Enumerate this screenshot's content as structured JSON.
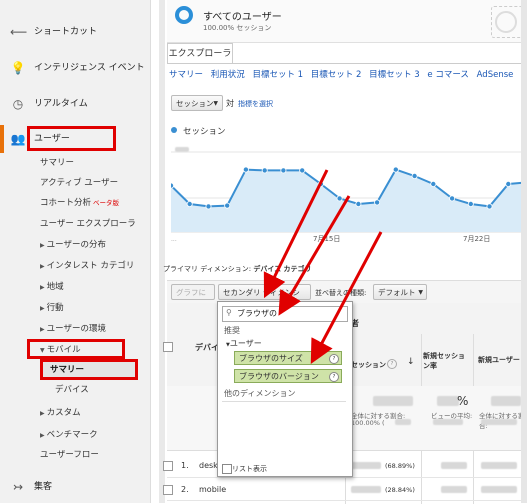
{
  "sidebar": {
    "shortcut": "ショートカット",
    "intelligence": "インテリジェンス イベント",
    "realtime": "リアルタイム",
    "users": "ユーザー",
    "users_items": {
      "summary": "サマリー",
      "active_users": "アクティブ ユーザー",
      "cohort": "コホート分析",
      "beta": "ベータ版",
      "user_explorer": "ユーザー エクスプローラ",
      "user_distribution": "ユーザーの分布",
      "interest_category": "インタレスト カテゴリ",
      "region": "地域",
      "behavior": "行動",
      "user_environment": "ユーザーの環境",
      "mobile": "モバイル",
      "mobile_summary": "サマリー",
      "devices": "デバイス",
      "custom": "カスタム",
      "benchmark": "ベンチマーク",
      "user_flow": "ユーザーフロー"
    },
    "acquisition": "集客"
  },
  "segment": {
    "title": "すべてのユーザー",
    "subtitle": "100.00% セッション"
  },
  "explorer_tab": "エクスプローラ",
  "subtabs": [
    "サマリー",
    "利用状況",
    "目標セット 1",
    "目標セット 2",
    "目標セット 3",
    "e コマース",
    "AdSense"
  ],
  "metric_select": "セッション",
  "vs": "対",
  "select_metric": "指標を選択",
  "chart_legend": "セッション",
  "chart_data": {
    "type": "line",
    "series": [
      {
        "name": "セッション",
        "values": [
          58,
          35,
          32,
          33,
          78,
          77,
          77,
          77,
          60,
          42,
          35,
          37,
          78,
          70,
          60,
          42,
          35,
          32,
          60,
          62
        ]
      }
    ],
    "x_ticks": [
      "7月15日",
      "7月22日"
    ],
    "color": "#3a8fd2"
  },
  "primary_dimension_label": "プライマリ ディメンション:",
  "primary_dimension_value": "デバイス カテゴリ",
  "toolbar": {
    "graph_btn": "グラフに表示",
    "secondary_dim": "セカンダリ ディメンション",
    "sort_type_label": "並べ替えの種類:",
    "sort_default": "デフォルト"
  },
  "dropdown": {
    "search_value": "ブラウザの",
    "recommended": "推奨",
    "user_group": "ユーザー",
    "item1": "ブラウザのサイズ",
    "item2": "ブラウザのバージョン",
    "other_dims": "他のディメンション",
    "list_view": "リスト表示"
  },
  "table": {
    "col_device": "デバイ",
    "group_header": "者",
    "col_sessions": "セッション",
    "col_new_session_rate": "新規セッション率",
    "col_new_users": "新規ユーザー",
    "total_pct_label": "全体に対する割合:",
    "total_pct": "100.00% (",
    "view_avg_label": "ビューの平均:",
    "percent": "%",
    "rows": [
      {
        "num": "1.",
        "device": "desk",
        "pct": "(68.89%)"
      },
      {
        "num": "2.",
        "device": "mobile",
        "pct": "(28.84%)"
      }
    ]
  },
  "colors": {
    "accent_red": "#e00000",
    "link_blue": "#1a57b5",
    "line_blue": "#3a8fd2",
    "green_item": "#cfe3a8"
  }
}
